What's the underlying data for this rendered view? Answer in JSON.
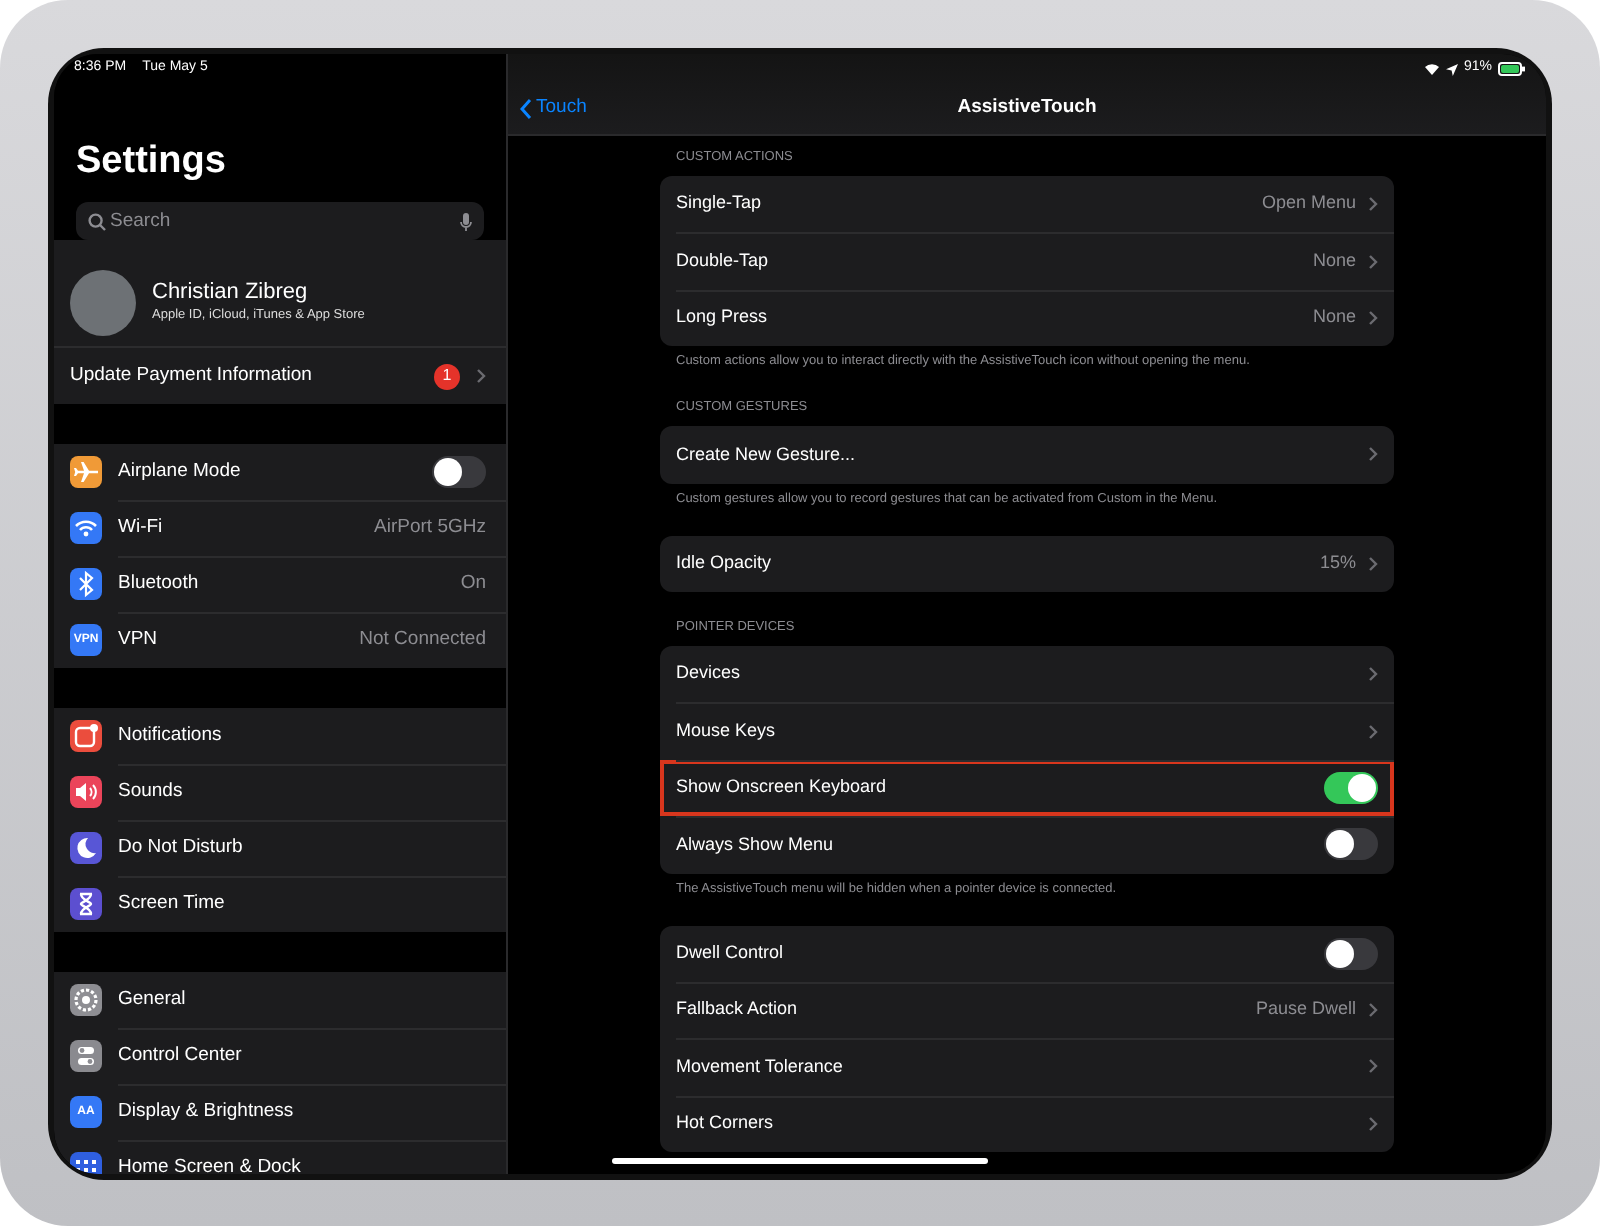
{
  "status_bar": {
    "time": "8:36 PM",
    "date": "Tue May 5",
    "battery": "91%"
  },
  "sidebar": {
    "title": "Settings",
    "search": {
      "placeholder": "Search"
    },
    "profile": {
      "name": "Christian Zibreg",
      "subtitle": "Apple ID, iCloud, iTunes & App Store"
    },
    "update": {
      "label": "Update Payment Information",
      "badge": "1"
    },
    "groups": [
      {
        "items": [
          {
            "label": "Airplane Mode",
            "kind": "toggle",
            "on": false,
            "color": "#f09a37"
          },
          {
            "label": "Wi-Fi",
            "kind": "link",
            "value": "AirPort 5GHz",
            "color": "#3478f6"
          },
          {
            "label": "Bluetooth",
            "kind": "link",
            "value": "On",
            "color": "#3478f6"
          },
          {
            "label": "VPN",
            "kind": "link",
            "value": "Not Connected",
            "color": "#3478f6",
            "icon_text": "VPN"
          }
        ]
      },
      {
        "items": [
          {
            "label": "Notifications",
            "kind": "link",
            "color": "#eb4d3d"
          },
          {
            "label": "Sounds",
            "kind": "link",
            "color": "#eb445a"
          },
          {
            "label": "Do Not Disturb",
            "kind": "link",
            "color": "#5856d6"
          },
          {
            "label": "Screen Time",
            "kind": "link",
            "color": "#5c4fd0"
          }
        ]
      },
      {
        "items": [
          {
            "label": "General",
            "kind": "link",
            "color": "#8e8e93"
          },
          {
            "label": "Control Center",
            "kind": "link",
            "color": "#8a8a8f"
          },
          {
            "label": "Display & Brightness",
            "kind": "link",
            "color": "#3478f6",
            "icon_text": "AA"
          },
          {
            "label": "Home Screen & Dock",
            "kind": "link",
            "color": "#2f5fe0"
          }
        ]
      }
    ]
  },
  "detail": {
    "back_label": "Touch",
    "title": "AssistiveTouch",
    "sections": [
      {
        "header": "CUSTOM ACTIONS",
        "rows": [
          {
            "label": "Single-Tap",
            "kind": "disclosure",
            "value": "Open Menu",
            "highlighted": false
          },
          {
            "label": "Double-Tap",
            "kind": "disclosure",
            "value": "None",
            "highlighted": false
          },
          {
            "label": "Long Press",
            "kind": "disclosure",
            "value": "None",
            "highlighted": false
          }
        ],
        "footer": "Custom actions allow you to interact directly with the AssistiveTouch icon without opening the menu."
      },
      {
        "header": "CUSTOM GESTURES",
        "rows": [
          {
            "label": "Create New Gesture...",
            "kind": "disclosure",
            "highlighted": false
          }
        ],
        "footer": "Custom gestures allow you to record gestures that can be activated from Custom in the Menu."
      },
      {
        "rows": [
          {
            "label": "Idle Opacity",
            "kind": "disclosure",
            "value": "15%",
            "highlighted": false
          }
        ]
      },
      {
        "header": "POINTER DEVICES",
        "rows": [
          {
            "label": "Devices",
            "kind": "disclosure",
            "highlighted": false
          },
          {
            "label": "Mouse Keys",
            "kind": "disclosure",
            "highlighted": false
          },
          {
            "label": "Show Onscreen Keyboard",
            "kind": "toggle",
            "on": true,
            "highlighted": true
          },
          {
            "label": "Always Show Menu",
            "kind": "toggle",
            "on": false,
            "highlighted": false
          }
        ],
        "footer": "The AssistiveTouch menu will be hidden when a pointer device is connected."
      },
      {
        "rows": [
          {
            "label": "Dwell Control",
            "kind": "toggle",
            "on": false,
            "highlighted": false
          },
          {
            "label": "Fallback Action",
            "kind": "disclosure",
            "value": "Pause Dwell",
            "highlighted": false
          },
          {
            "label": "Movement Tolerance",
            "kind": "disclosure",
            "highlighted": false
          },
          {
            "label": "Hot Corners",
            "kind": "disclosure",
            "highlighted": false
          }
        ]
      }
    ]
  }
}
